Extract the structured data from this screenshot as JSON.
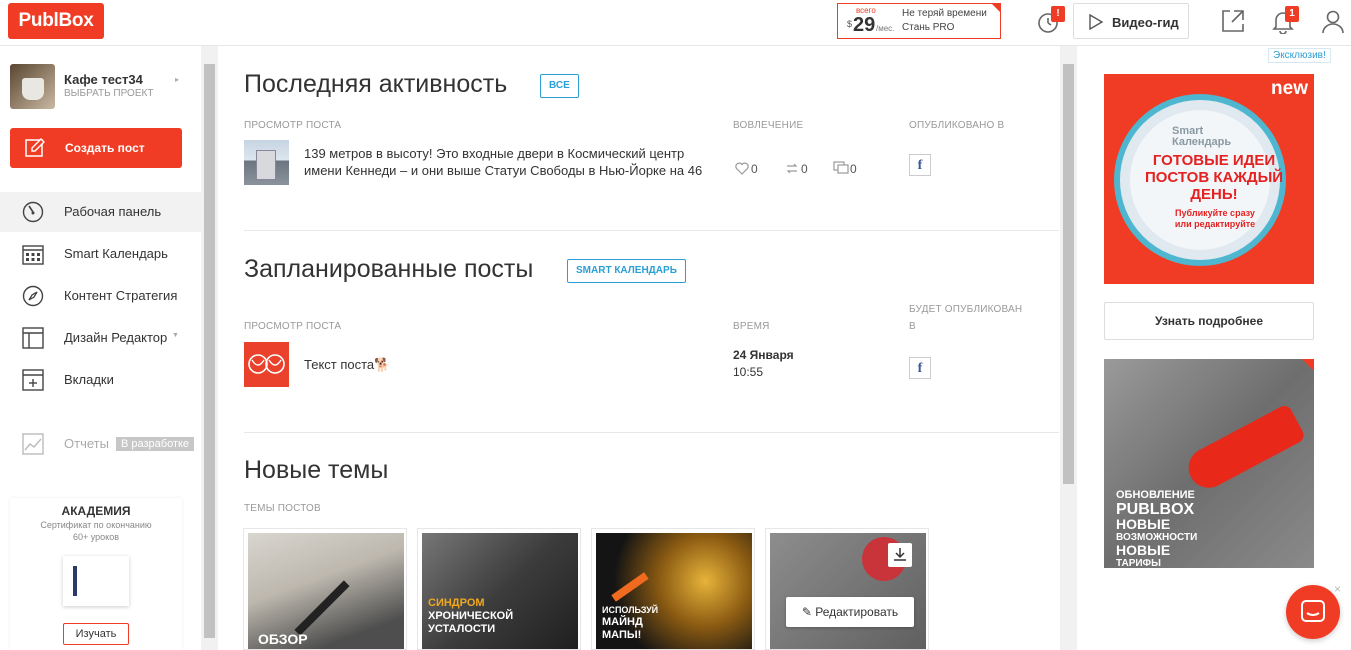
{
  "header": {
    "logo": "PublBox",
    "promo": {
      "top_label": "всего",
      "currency": "$",
      "price": "29",
      "per": "/мес.",
      "line1": "Не теряй времени",
      "line2": "Стань PRO"
    },
    "timer_badge": "!",
    "video_guide": "Видео-гид",
    "notif_badge": "1",
    "icons": [
      "timer-icon",
      "play-icon",
      "external-link-icon",
      "bell-icon",
      "user-icon"
    ]
  },
  "sidebar": {
    "project_name": "Кафе тест34",
    "project_sub": "ВЫБРАТЬ ПРОЕКТ",
    "create_post": "Создать пост",
    "items": [
      {
        "label": "Рабочая панель",
        "icon": "dashboard-icon",
        "active": true
      },
      {
        "label": "Smart Календарь",
        "icon": "calendar-icon"
      },
      {
        "label": "Контент Стратегия",
        "icon": "compass-icon"
      },
      {
        "label": "Дизайн Редактор",
        "icon": "layout-icon"
      },
      {
        "label": "Вкладки",
        "icon": "tabs-icon"
      },
      {
        "label": "Отчеты",
        "icon": "chart-icon",
        "badge": "В разработке"
      }
    ],
    "academy": {
      "title": "АКАДЕМИЯ",
      "line1": "Сертификат по окончанию",
      "line2": "60+ уроков",
      "button": "Изучать"
    }
  },
  "main": {
    "recent": {
      "title": "Последняя активность",
      "button": "ВСЕ",
      "col_preview": "ПРОСМОТР ПОСТА",
      "col_engagement": "ВОВЛЕЧЕНИЕ",
      "col_published": "ОПУБЛИКОВАНО В",
      "post_text_1": "139 метров в высоту! Это входные двери в Космический центр",
      "post_text_2": "имени Кеннеди – и они выше Статуи Свободы в Нью-Йорке на 46",
      "likes": "0",
      "shares": "0",
      "comments": "0"
    },
    "scheduled": {
      "title": "Запланированные посты",
      "button": "SMART КАЛЕНДАРЬ",
      "col_preview": "ПРОСМОТР ПОСТА",
      "col_time": "ВРЕМЯ",
      "col_will_publish_1": "БУДЕТ ОПУБЛИКОВАН",
      "col_will_publish_2": "В",
      "post_text": "Текст поста🐕",
      "date": "24 Января",
      "time": "10:55"
    },
    "themes": {
      "title": "Новые темы",
      "subtitle": "ТЕМЫ ПОСТОВ",
      "cards": [
        {
          "caption": "ОБЗОР"
        },
        {
          "caption_1": "СИНДРОМ",
          "caption_2": "ХРОНИЧЕСКОЙ",
          "caption_3": "УСТАЛОСТИ"
        },
        {
          "caption_1": "ИСПОЛЬЗУЙ",
          "caption_2": "МАЙНД",
          "caption_3": "МАПЫ!"
        },
        {
          "edit": "Редактировать"
        }
      ]
    }
  },
  "right": {
    "exclusive": "Эксклюзив!",
    "ad1": {
      "badge": "new",
      "brand_1": "Smart",
      "brand_2": "Календарь",
      "headline": "ГОТОВЫЕ ИДЕИ ПОСТОВ КАЖДЫЙ ДЕНЬ!",
      "sub_1": "Публикуйте сразу",
      "sub_2": "или редактируйте"
    },
    "learn_more": "Узнать подробнее",
    "ad2": {
      "l1": "ОБНОВЛЕНИЕ",
      "l2": "PUBLBOX",
      "l3": "НОВЫЕ",
      "l4": "ВОЗМОЖНОСТИ",
      "l5": "НОВЫЕ",
      "l6": "ТАРИФЫ"
    }
  },
  "colors": {
    "accent": "#f03c24",
    "link": "#2a9fd6"
  }
}
